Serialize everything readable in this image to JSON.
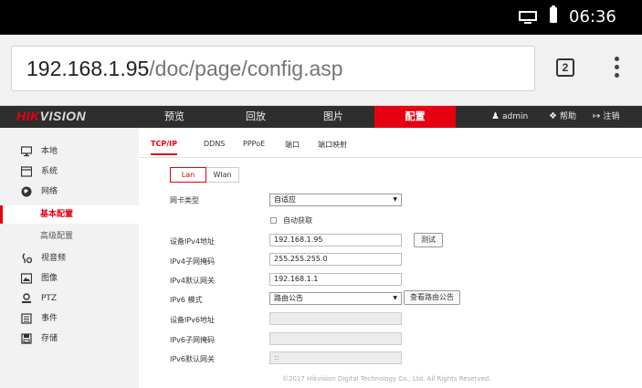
{
  "statusbar": {
    "time": "06:36"
  },
  "browser": {
    "url_host": "192.168.1.95",
    "url_path": "/doc/page/config.asp",
    "tab_count": "2"
  },
  "logo": {
    "hik": "HIK",
    "vision": "VISION"
  },
  "nav": {
    "items": [
      {
        "label": "预览"
      },
      {
        "label": "回放"
      },
      {
        "label": "图片"
      },
      {
        "label": "配置"
      }
    ],
    "user": "admin",
    "help": "帮助",
    "logout": "注销"
  },
  "sidebar": {
    "local": "本地",
    "system": "系统",
    "network": "网络",
    "basic_config": "基本配置",
    "advanced_config": "高级配置",
    "video_audio": "视音频",
    "image": "图像",
    "ptz": "PTZ",
    "event": "事件",
    "storage": "存储"
  },
  "subtabs": [
    "TCP/IP",
    "DDNS",
    "PPPoE",
    "端口",
    "端口映射"
  ],
  "lanwlan": {
    "lan": "Lan",
    "wlan": "Wlan"
  },
  "form": {
    "nic_type_label": "网卡类型",
    "nic_type_value": "自适应",
    "dhcp_label": "自动获取",
    "ipv4_addr_label": "设备IPv4地址",
    "ipv4_addr_value": "192.168.1.95",
    "test_button": "测试",
    "ipv4_mask_label": "IPv4子网掩码",
    "ipv4_mask_value": "255.255.255.0",
    "ipv4_gw_label": "IPv4默认网关",
    "ipv4_gw_value": "192.168.1.1",
    "ipv6_mode_label": "IPv6 模式",
    "ipv6_mode_value": "路由公告",
    "view_ra_button": "查看路由公告",
    "ipv6_addr_label": "设备IPv6地址",
    "ipv6_addr_value": "",
    "ipv6_mask_label": "IPv6子网掩码",
    "ipv6_mask_value": "",
    "ipv6_gw_label": "IPv6默认网关",
    "ipv6_gw_value": "::"
  },
  "footer": "©2017 Hikvision Digital Technology Co., Ltd. All Rights Reserved."
}
